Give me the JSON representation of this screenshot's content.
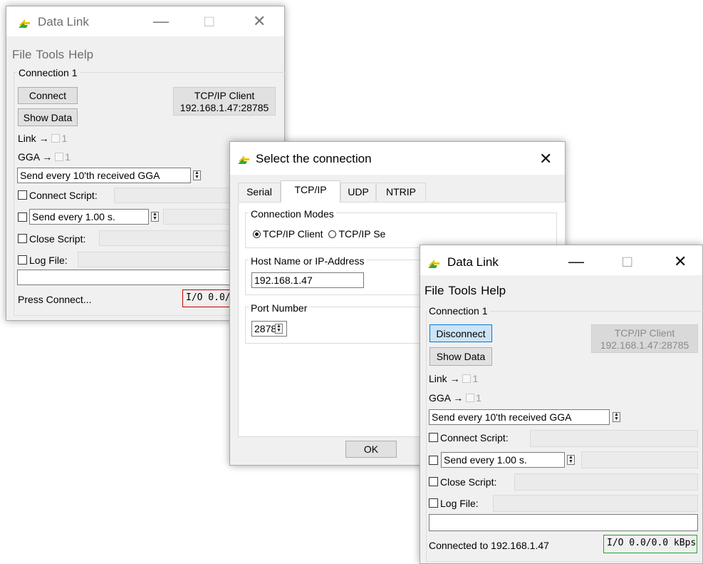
{
  "back_window": {
    "title": "Data Link",
    "menu": [
      "File",
      "Tools",
      "Help"
    ],
    "group_label": "Connection 1",
    "connect_button": "Connect",
    "show_data_button": "Show Data",
    "connection_info_line1": "TCP/IP Client",
    "connection_info_line2": "192.168.1.47:28785",
    "link_label": "Link →",
    "link_count": "1",
    "gga_label": "GGA →",
    "gga_count": "1",
    "gga_mode_select": "Send every 10'th received GGA",
    "connect_script_label": "Connect Script:",
    "interval_select": "Send every 1.00 s.",
    "close_script_label": "Close Script:",
    "log_file_label": "Log File:",
    "status_text": "Press Connect...",
    "io_text": "I/O 0.0/0.0 kBps",
    "io_border_color": "#c00000"
  },
  "dialog": {
    "title": "Select the connection",
    "tabs": [
      "Serial",
      "TCP/IP",
      "UDP",
      "NTRIP"
    ],
    "active_tab": "TCP/IP",
    "modes_label": "Connection Modes",
    "mode_client": "TCP/IP Client",
    "mode_server": "TCP/IP Se",
    "host_label": "Host Name or IP-Address",
    "host_value": "192.168.1.47",
    "port_label": "Port Number",
    "port_value": "28785",
    "ok_button": "OK"
  },
  "front_window": {
    "title": "Data Link",
    "menu": [
      "File",
      "Tools",
      "Help"
    ],
    "group_label": "Connection 1",
    "disconnect_button": "Disconnect",
    "show_data_button": "Show Data",
    "connection_info_line1": "TCP/IP Client",
    "connection_info_line2": "192.168.1.47:28785",
    "link_label": "Link →",
    "link_count": "1",
    "gga_label": "GGA →",
    "gga_count": "1",
    "gga_mode_select": "Send every 10'th received GGA",
    "connect_script_label": "Connect Script:",
    "interval_select": "Send every 1.00 s.",
    "close_script_label": "Close Script:",
    "log_file_label": "Log File:",
    "status_text": "Connected to 192.168.1.47",
    "io_text": "I/O 0.0/0.0 kBps",
    "io_border_color": "#2aa52a"
  }
}
